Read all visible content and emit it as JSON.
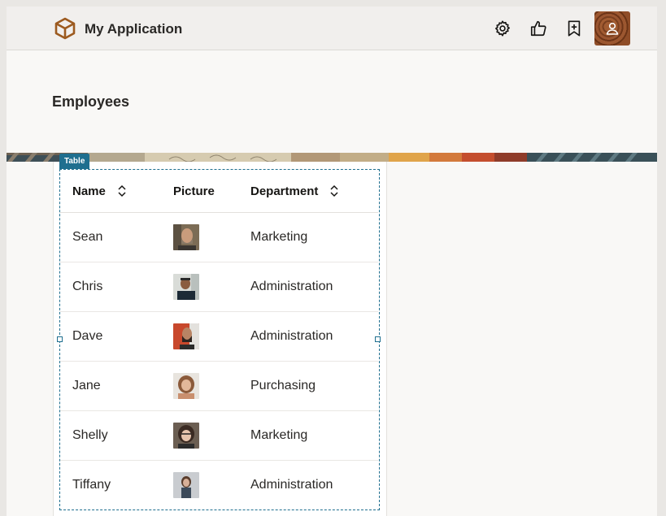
{
  "header": {
    "title": "My Application",
    "logo_icon": "cube-icon",
    "icons": [
      "gear-icon",
      "thumbs-up-icon",
      "bookmark-add-icon",
      "user-icon"
    ]
  },
  "page": {
    "title": "Employees"
  },
  "table": {
    "tag": "Table",
    "columns": [
      {
        "label": "Name",
        "sortable": true
      },
      {
        "label": "Picture",
        "sortable": false
      },
      {
        "label": "Department",
        "sortable": true
      }
    ],
    "rows": [
      {
        "name": "Sean",
        "department": "Marketing"
      },
      {
        "name": "Chris",
        "department": "Administration"
      },
      {
        "name": "Dave",
        "department": "Administration"
      },
      {
        "name": "Jane",
        "department": "Purchasing"
      },
      {
        "name": "Shelly",
        "department": "Marketing"
      },
      {
        "name": "Tiffany",
        "department": "Administration"
      }
    ]
  },
  "colors": {
    "accent": "#1f6f8f",
    "logo": "#9c5a1f",
    "header_bg": "#f1efed"
  }
}
